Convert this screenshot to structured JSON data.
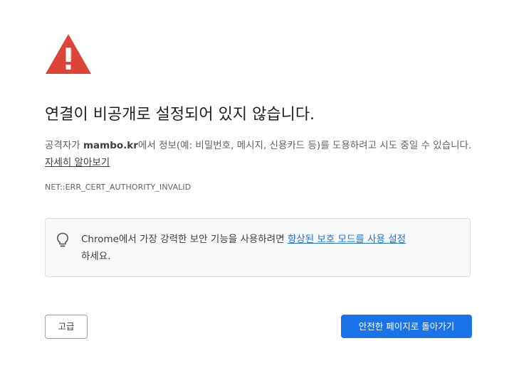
{
  "interstitial": {
    "icon": "warning-triangle-icon",
    "title": "연결이 비공개로 설정되어 있지 않습니다.",
    "message_prefix": "공격자가 ",
    "domain": "mambo.kr",
    "message_suffix": "에서 정보(예: 비밀번호, 메시지, 신용카드 등)를 도용하려고 시도 중일 수 있습니다. ",
    "learn_more_label": "자세히 알아보기",
    "error_code": "NET::ERR_CERT_AUTHORITY_INVALID"
  },
  "tip": {
    "icon": "lightbulb-icon",
    "text_prefix": "Chrome에서 가장 강력한 보안 기능을 사용하려면 ",
    "link_label": "향상된 보호 모드를 사용 설정",
    "text_suffix": "하세요."
  },
  "buttons": {
    "advanced_label": "고급",
    "back_to_safety_label": "안전한 페이지로 돌아가기"
  },
  "colors": {
    "warning_red": "#db4437",
    "primary_blue": "#1a73e8",
    "text_dark": "#202124",
    "text_muted": "#5f6368"
  }
}
